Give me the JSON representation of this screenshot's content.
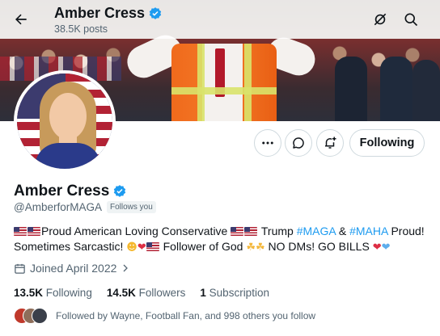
{
  "header": {
    "name": "Amber Cress",
    "post_count": "38.5K posts"
  },
  "icons": {
    "back": "arrow-left-icon",
    "notifications_off": "bell-slash-icon",
    "search": "search-icon",
    "more": "more-dots-icon",
    "message": "message-icon",
    "subscribe": "bell-plus-icon",
    "calendar": "calendar-icon",
    "verified": "verified-badge-icon"
  },
  "profile": {
    "name": "Amber Cress",
    "handle": "@AmberforMAGA",
    "follows_you": "Follows you",
    "following_button": "Following",
    "bio": {
      "part1": "Proud American Loving Conservative",
      "part2": "Trump",
      "tag_maga": "#MAGA",
      "amp": "&",
      "tag_maha": "#MAHA",
      "part3": "Proud!",
      "part4": "Sometimes Sarcastic!",
      "part5": "Follower of God",
      "part6": "NO DMs!  GO BILLS"
    },
    "joined": "Joined April 2022",
    "stats": {
      "following_count": "13.5K",
      "following_label": "Following",
      "followers_count": "14.5K",
      "followers_label": "Followers",
      "subscription_count": "1",
      "subscription_label": "Subscription"
    },
    "followed_by": "Followed by Wayne, Football Fan, and 998 others you follow"
  },
  "colors": {
    "accent": "#1d9bf0",
    "text": "#0f1419",
    "muted": "#536471"
  }
}
